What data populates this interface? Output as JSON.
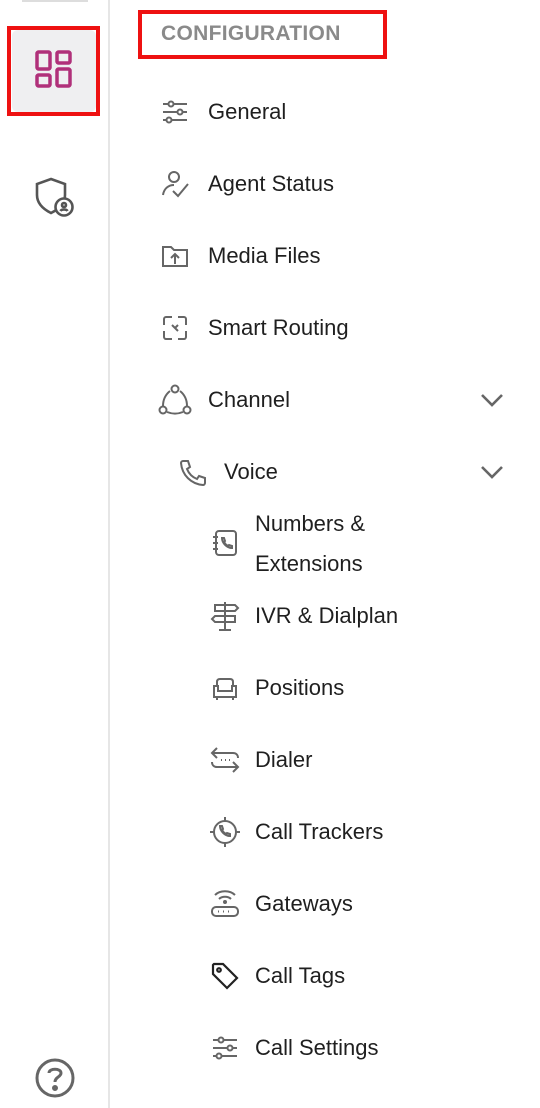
{
  "rail": {
    "dashboard_icon": "dashboard-grid-icon",
    "shield_icon": "shield-user-icon",
    "help_icon": "help-circle-icon",
    "accent_color": "#b0307a",
    "highlight_color": "#ee1111"
  },
  "section": {
    "title": "CONFIGURATION"
  },
  "menu": {
    "general": "General",
    "agent_status": "Agent Status",
    "media_files": "Media Files",
    "smart_routing": "Smart Routing",
    "channel": "Channel",
    "voice": "Voice",
    "numbers_extensions": "Numbers & Extensions",
    "ivr_dialplan": "IVR & Dialplan",
    "positions": "Positions",
    "dialer": "Dialer",
    "call_trackers": "Call Trackers",
    "gateways": "Gateways",
    "call_tags": "Call Tags",
    "call_settings": "Call Settings"
  }
}
